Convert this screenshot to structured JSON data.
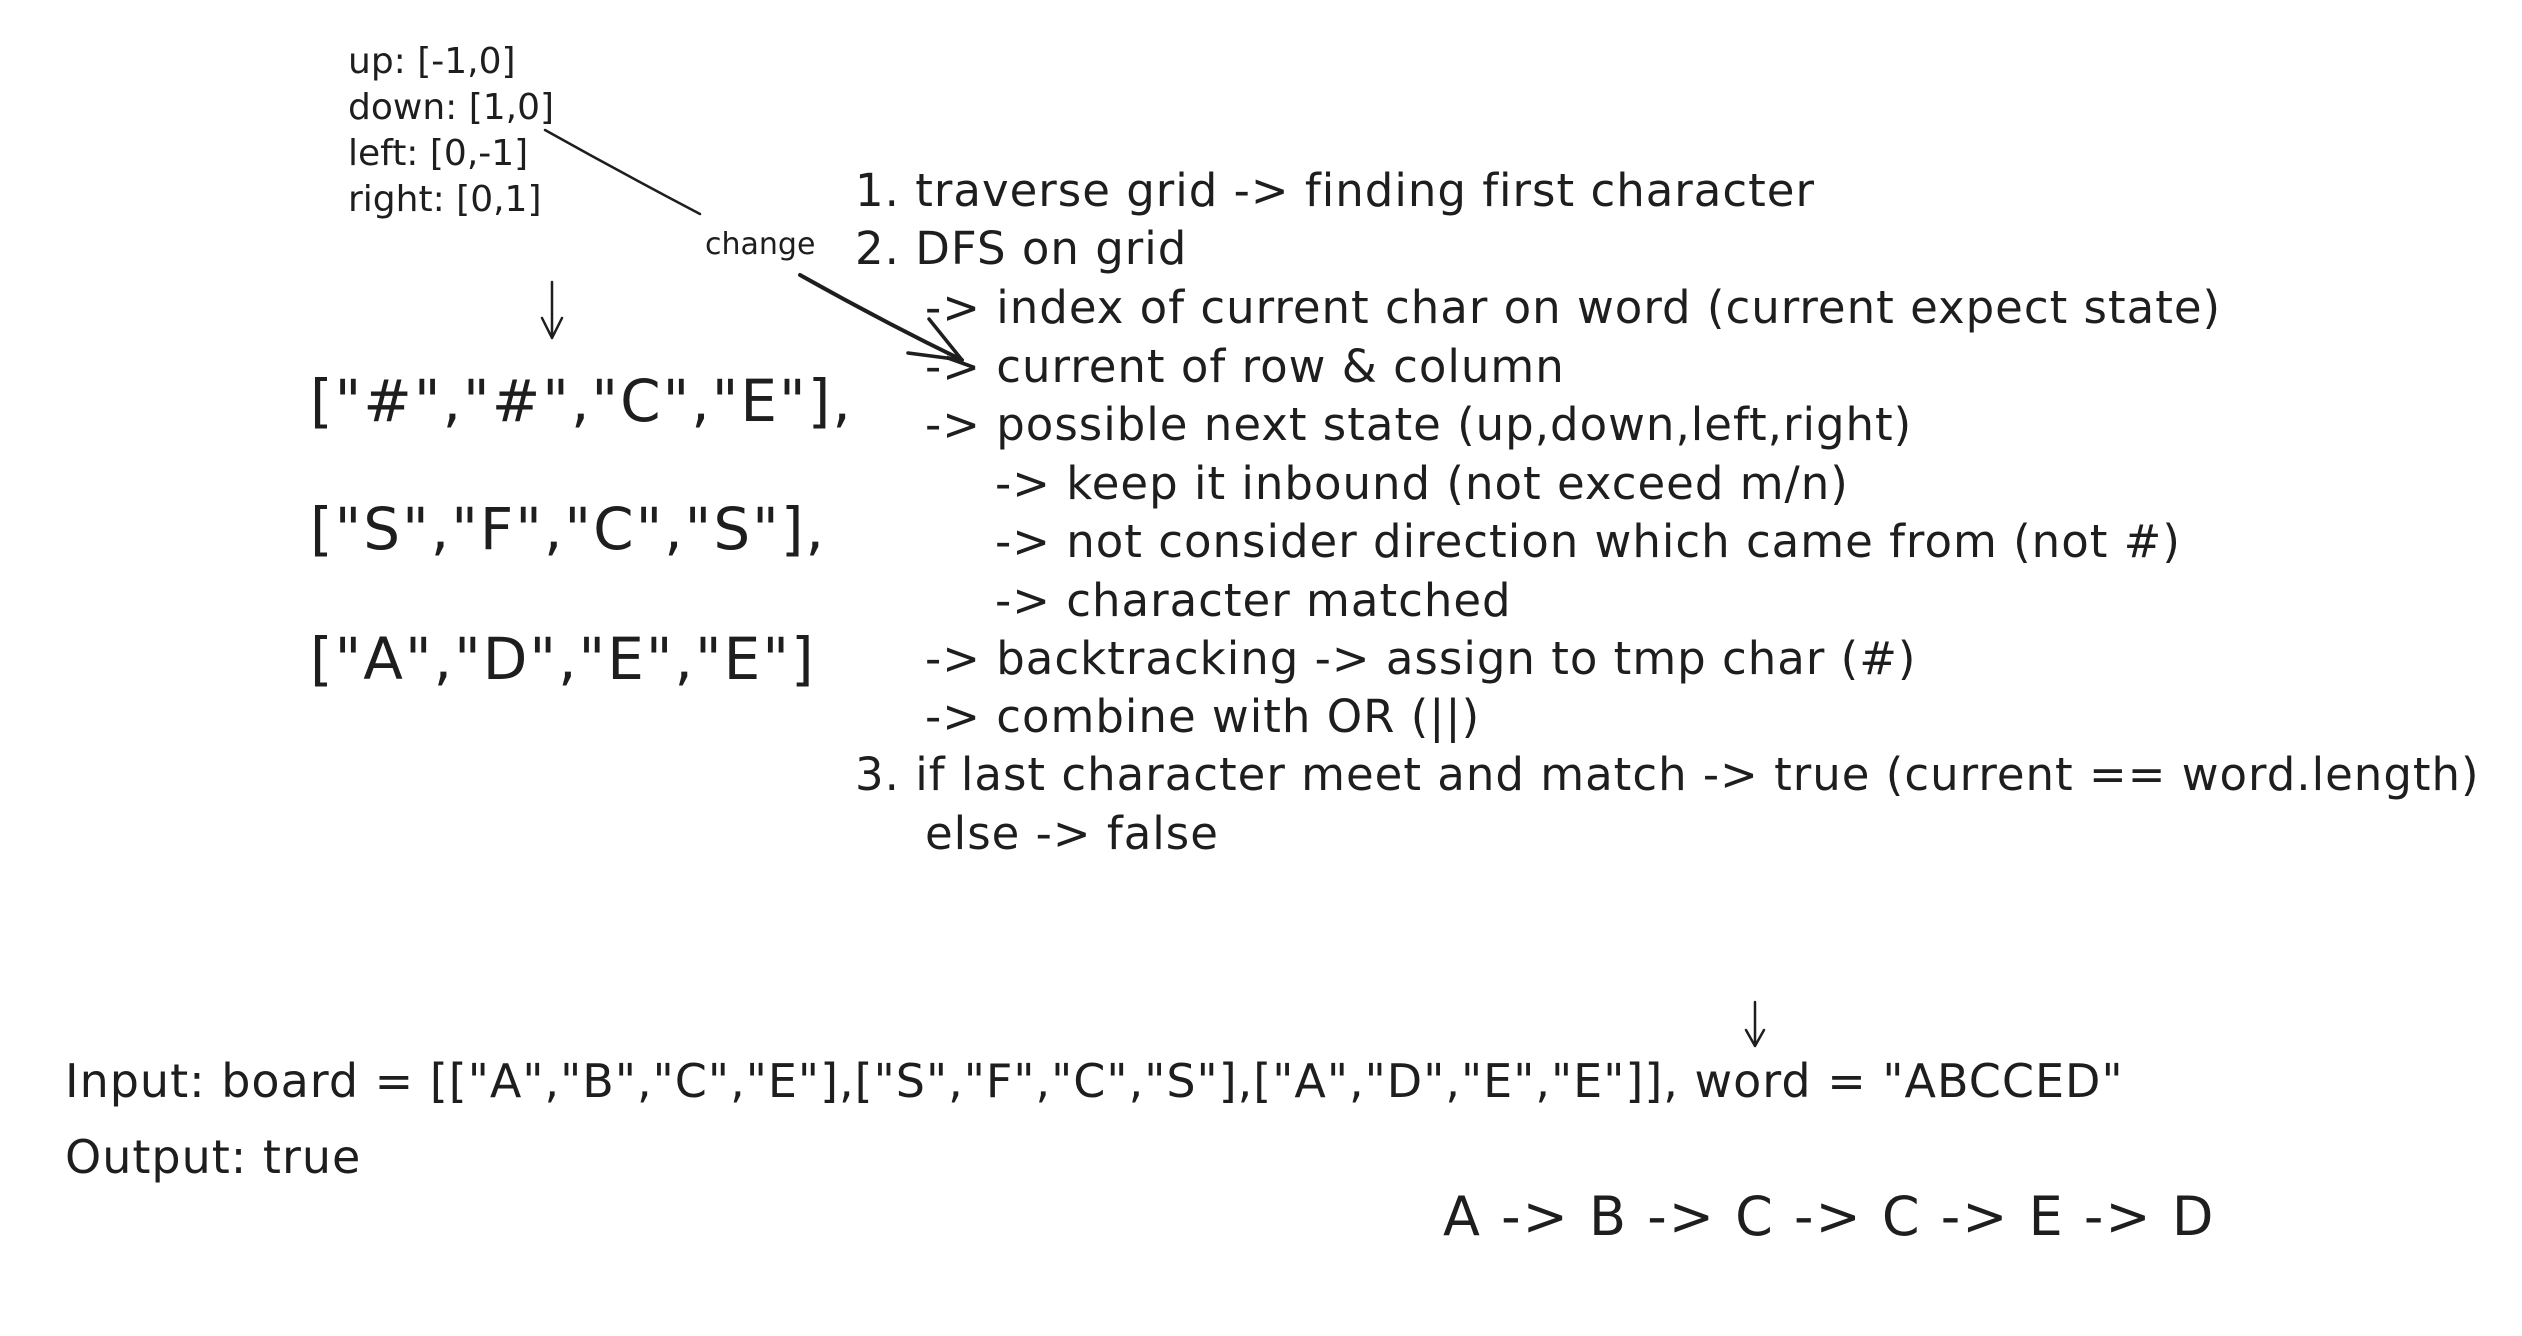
{
  "directions": [
    "up: [-1,0]",
    "down: [1,0]",
    "left: [0,-1]",
    "right: [0,1]"
  ],
  "change_label": "change",
  "grid_rows": [
    "[\"#\",\"#\",\"C\",\"E\"],",
    "[\"S\",\"F\",\"C\",\"S\"],",
    "[\"A\",\"D\",\"E\",\"E\"]"
  ],
  "steps": [
    "1. traverse grid -> finding first character",
    "2. DFS on grid",
    "-> index of current char on word (current expect state)",
    "-> current of row & column",
    "-> possible next state (up,down,left,right)",
    "-> keep it inbound (not exceed m/n)",
    "-> not consider direction which came from (not #)",
    "-> character matched",
    "-> backtracking -> assign to tmp char (#)",
    "-> combine with OR (||)",
    "3. if last character meet and match -> true (current == word.length)",
    "else -> false"
  ],
  "input_line": "Input: board = [[\"A\",\"B\",\"C\",\"E\"],[\"S\",\"F\",\"C\",\"S\"],[\"A\",\"D\",\"E\",\"E\"]], word = \"ABCCED\"",
  "output_line": "Output: true",
  "path_line": "A -> B -> C -> C -> E -> D",
  "stroke_color": "#1e1e1e"
}
